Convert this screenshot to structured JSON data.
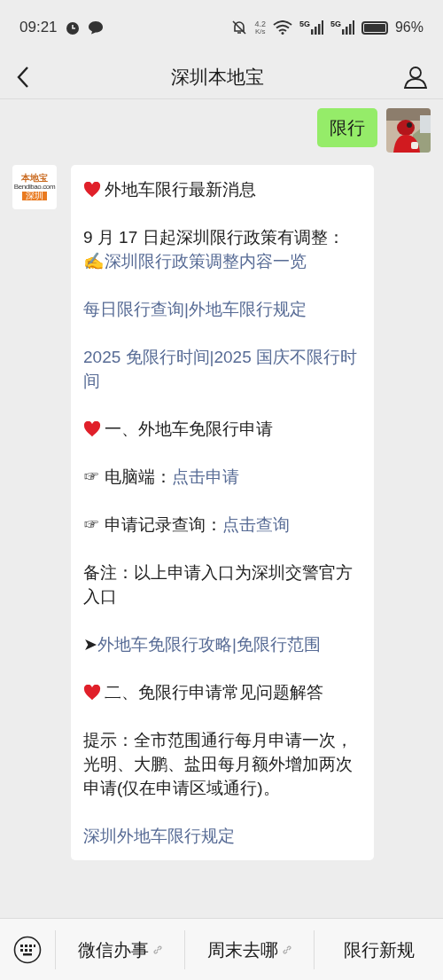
{
  "status_bar": {
    "time": "09:21",
    "speed_value": "4.2",
    "speed_unit": "K/s",
    "networks": [
      "5G",
      "5G"
    ],
    "battery": "96%"
  },
  "header": {
    "title": "深圳本地宝"
  },
  "messages": [
    {
      "kind": "user",
      "text": "限行"
    },
    {
      "kind": "bot",
      "avatar": {
        "brand": "本地宝",
        "site": "Bendibao.com",
        "city": "深圳"
      },
      "blocks": [
        {
          "kind": "heading",
          "lines": [
            [
              {
                "kind": "text",
                "text": "外地车限行最新消息"
              }
            ]
          ]
        },
        {
          "kind": "body",
          "lines": [
            [
              {
                "kind": "text",
                "text": "9 月 17 日起深圳限行政策有调整："
              }
            ],
            [
              {
                "kind": "text",
                "text": "✍"
              },
              {
                "kind": "link",
                "text": "深圳限行政策调整内容一览"
              }
            ]
          ]
        },
        {
          "kind": "body",
          "lines": [
            [
              {
                "kind": "link",
                "text": "每日限行查询|外地车限行规定"
              }
            ]
          ]
        },
        {
          "kind": "body",
          "lines": [
            [
              {
                "kind": "link",
                "text": "2025 免限行时间|2025 国庆不限行时间"
              }
            ]
          ]
        },
        {
          "kind": "heading",
          "lines": [
            [
              {
                "kind": "text",
                "text": "一、外地车免限行申请"
              }
            ]
          ]
        },
        {
          "kind": "body",
          "lines": [
            [
              {
                "kind": "text",
                "text": "☞ 电脑端："
              },
              {
                "kind": "link",
                "text": "点击申请"
              }
            ]
          ]
        },
        {
          "kind": "body",
          "lines": [
            [
              {
                "kind": "text",
                "text": "☞ 申请记录查询："
              },
              {
                "kind": "link",
                "text": "点击查询"
              }
            ]
          ]
        },
        {
          "kind": "body",
          "lines": [
            [
              {
                "kind": "text",
                "text": "备注：以上申请入口为深圳交警官方入口"
              }
            ]
          ]
        },
        {
          "kind": "body",
          "lines": [
            [
              {
                "kind": "text",
                "text": "➤ "
              },
              {
                "kind": "link",
                "text": "外地车免限行攻略|免限行范围"
              }
            ]
          ]
        },
        {
          "kind": "heading",
          "lines": [
            [
              {
                "kind": "text",
                "text": "二、免限行申请常见问题解答"
              }
            ]
          ]
        },
        {
          "kind": "body",
          "lines": [
            [
              {
                "kind": "text",
                "text": "提示：全市范围通行每月申请一次，光明、大鹏、盐田每月额外增加两次申请(仅在申请区域通行)。"
              }
            ]
          ]
        },
        {
          "kind": "body",
          "lines": [
            [
              {
                "kind": "link",
                "text": "深圳外地车限行规定"
              }
            ]
          ]
        }
      ]
    }
  ],
  "menu": [
    {
      "label": "微信办事",
      "link": true
    },
    {
      "label": "周末去哪",
      "link": true
    },
    {
      "label": "限行新规",
      "link": false
    }
  ]
}
